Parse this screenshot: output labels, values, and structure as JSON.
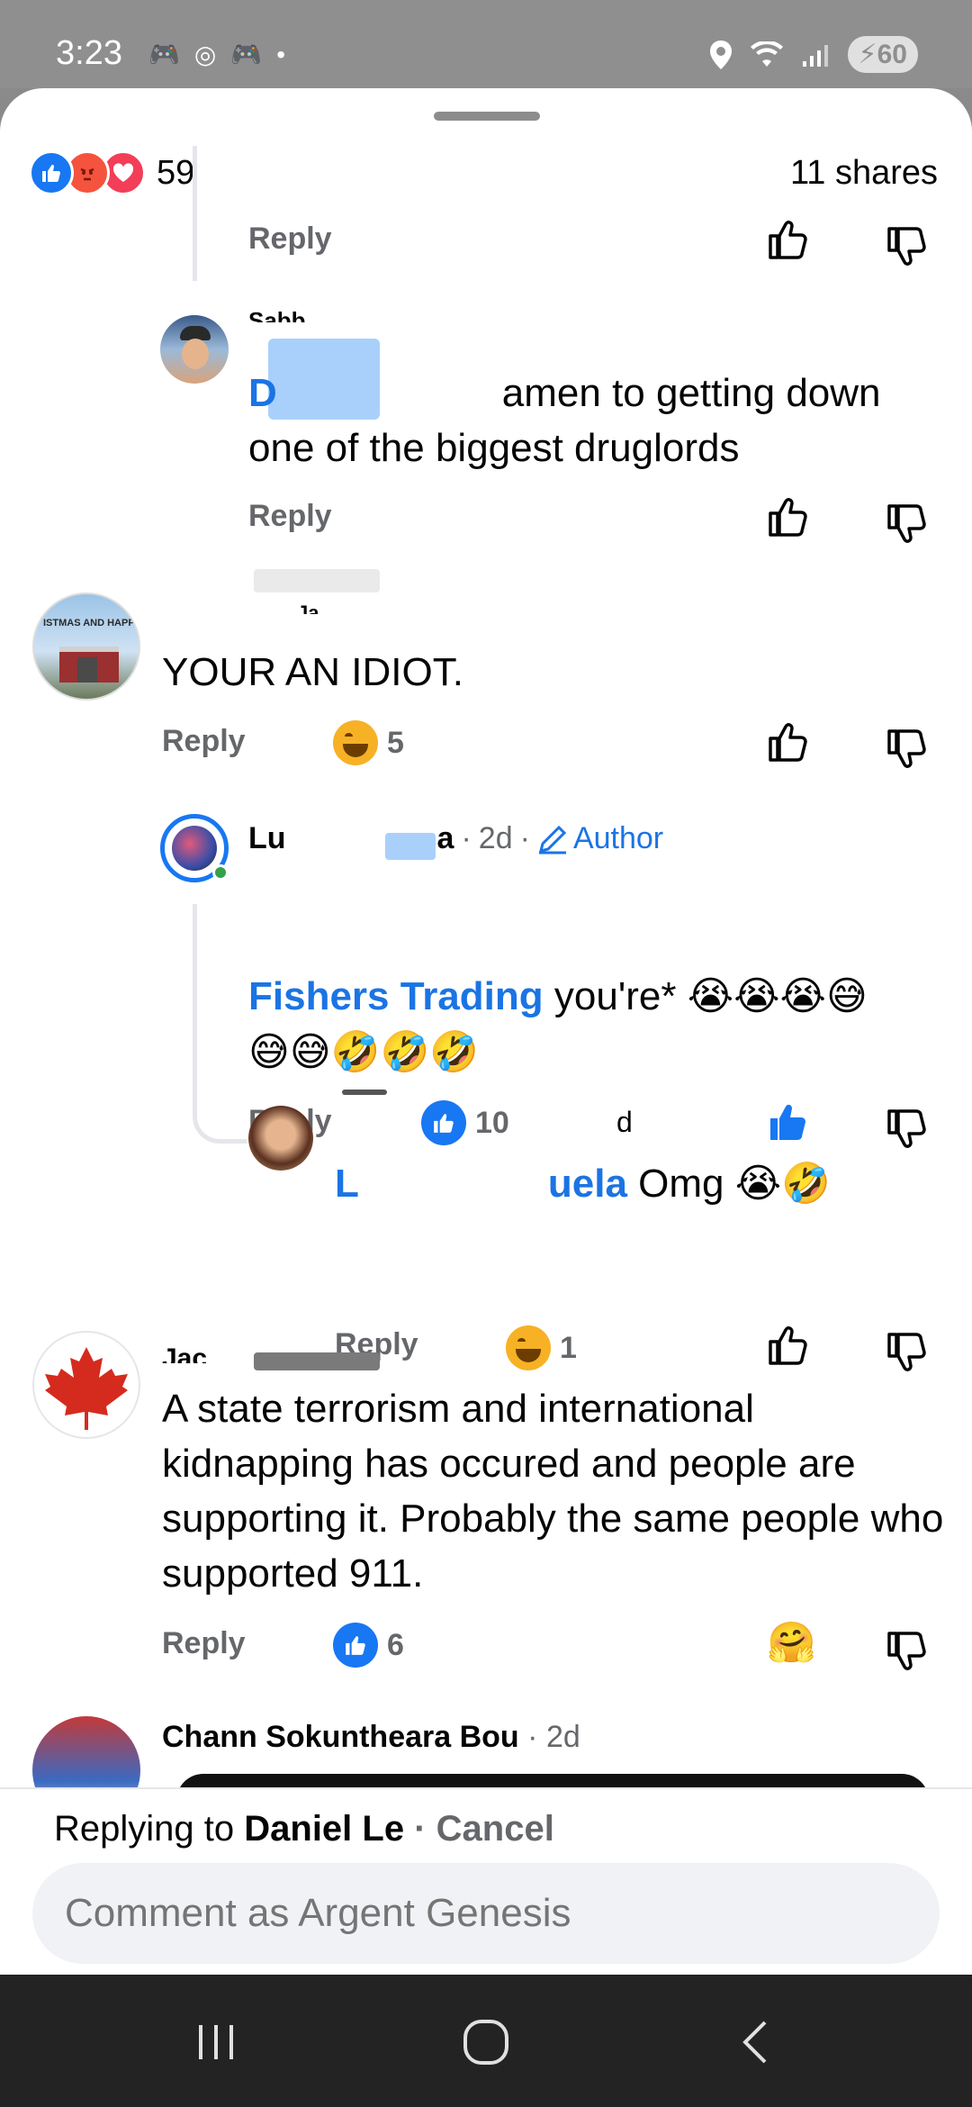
{
  "status_bar": {
    "time": "3:23",
    "battery": "60"
  },
  "summary": {
    "reaction_count": "59",
    "shares": "11 shares"
  },
  "comments": [
    {
      "reply": "Reply"
    },
    {
      "name_visible": "Sabb",
      "mention_initial": "D",
      "text": "amen to getting down one of the biggest druglords",
      "reply": "Reply"
    },
    {
      "name_visible": "Ja",
      "avatar_caption": "ISTMAS AND HAPPY",
      "text": "YOUR AN IDIOT.",
      "reply": "Reply",
      "reaction_count": "5"
    },
    {
      "name_start": "Lu",
      "name_end": "a",
      "time": "2d",
      "author_badge": "Author",
      "mention": "Fishers Trading",
      "text": "you're*",
      "reply": "Reply",
      "reaction_count": "10"
    },
    {
      "name_end": "d",
      "mention_start": "L",
      "mention_end": "uela",
      "text": "Omg",
      "reply": "Reply",
      "reaction_count": "1"
    },
    {
      "name_visible": "Jac",
      "text": "A state terrorism and international kidnapping has occured and people are supporting it. Probably the same people who supported 911.",
      "reply": "Reply",
      "reaction_count": "6"
    },
    {
      "name": "Chann Sokuntheara Bou",
      "time": "2d"
    }
  ],
  "reply_bar": {
    "prefix": "Replying to",
    "target": "Daniel Le",
    "separator": "·",
    "cancel": "Cancel"
  },
  "input": {
    "placeholder": "Comment as Argent Genesis"
  },
  "colors": {
    "accent": "#1877f2",
    "mention": "#1b74e4",
    "secondary_text": "#65676b"
  }
}
